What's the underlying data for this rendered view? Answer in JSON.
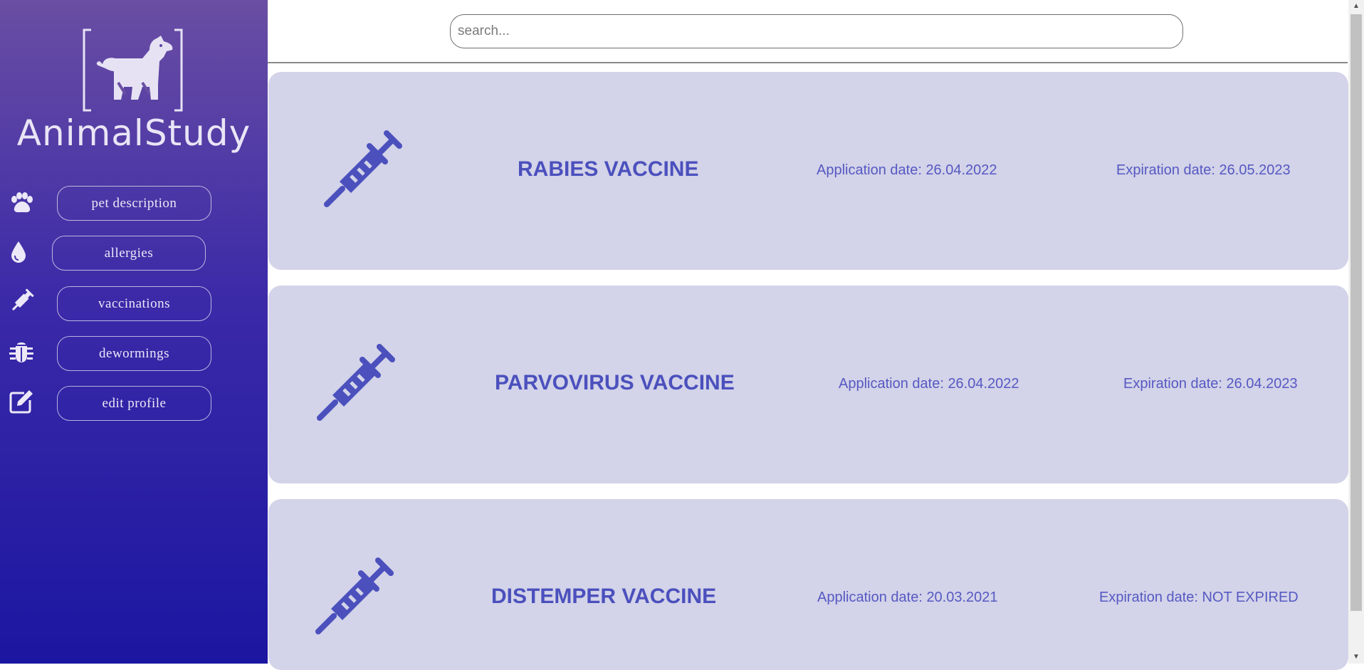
{
  "app": {
    "brand": "AnimalStudy"
  },
  "search": {
    "placeholder": "search..."
  },
  "nav": {
    "items": [
      {
        "label": "pet description",
        "icon": "paw-icon"
      },
      {
        "label": "allergies",
        "icon": "droplet-icon"
      },
      {
        "label": "vaccinations",
        "icon": "syringe-icon"
      },
      {
        "label": "dewormings",
        "icon": "bug-icon"
      },
      {
        "label": "edit profile",
        "icon": "edit-icon"
      }
    ]
  },
  "vaccines": [
    {
      "name": "RABIES VACCINE",
      "application": "Application date: 26.04.2022",
      "expiration": "Expiration date: 26.05.2023"
    },
    {
      "name": "PARVOVIRUS VACCINE",
      "application": "Application date: 26.04.2022",
      "expiration": "Expiration date: 26.04.2023"
    },
    {
      "name": "DISTEMPER VACCINE",
      "application": "Application date: 20.03.2021",
      "expiration": "Expiration date: NOT EXPIRED"
    }
  ],
  "colors": {
    "sidebar_top": "#6a4ea3",
    "sidebar_bottom": "#1b16a1",
    "card_bg": "#d3d3e9",
    "accent": "#4b50bd"
  }
}
